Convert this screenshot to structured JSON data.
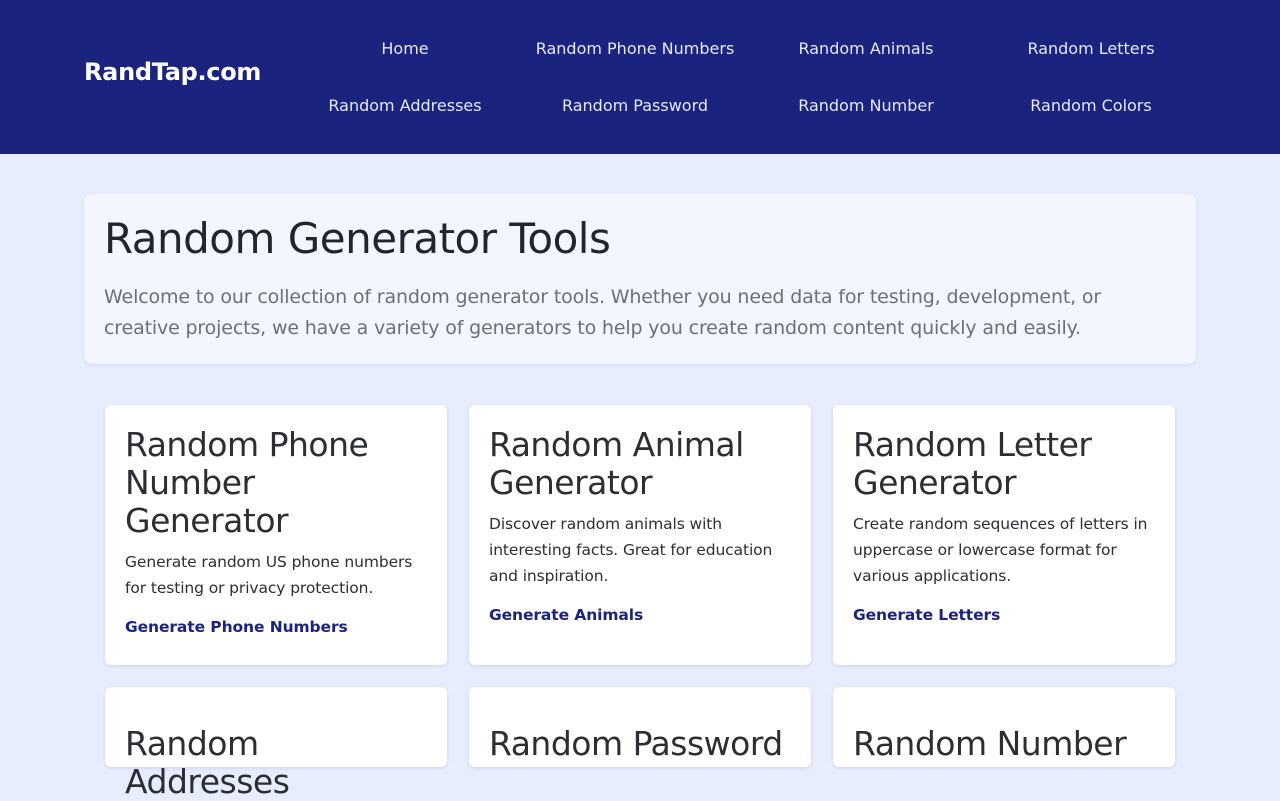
{
  "header": {
    "logo": "RandTap.com",
    "nav": [
      {
        "label": "Home"
      },
      {
        "label": "Random Phone Numbers"
      },
      {
        "label": "Random Animals"
      },
      {
        "label": "Random Letters"
      },
      {
        "label": "Random Addresses"
      },
      {
        "label": "Random Password"
      },
      {
        "label": "Random Number"
      },
      {
        "label": "Random Colors"
      }
    ]
  },
  "intro": {
    "title": "Random Generator Tools",
    "text": "Welcome to our collection of random generator tools. Whether you need data for testing, development, or creative projects, we have a variety of generators to help you create random content quickly and easily."
  },
  "cards": [
    {
      "title": "Random Phone Number Generator",
      "description": "Generate random US phone numbers for testing or privacy protection.",
      "link": "Generate Phone Numbers"
    },
    {
      "title": "Random Animal Generator",
      "description": "Discover random animals with interesting facts. Great for education and inspiration.",
      "link": "Generate Animals"
    },
    {
      "title": "Random Letter Generator",
      "description": "Create random sequences of letters in uppercase or lowercase format for various applications.",
      "link": "Generate Letters"
    },
    {
      "title": "Random Addresses"
    },
    {
      "title": "Random Password"
    },
    {
      "title": "Random Number"
    }
  ],
  "colors": {
    "header_bg": "#1b237e",
    "page_bg": "#e8edfe",
    "link": "#1b237e"
  }
}
